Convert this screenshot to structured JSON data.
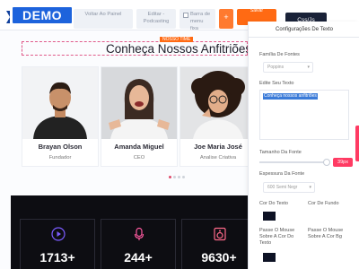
{
  "topbar": {
    "logo": "DEMO",
    "back_label": "Voltar Ao Painel",
    "edit_label": "Editar - Podcasting",
    "menu_fixed_label": "Barra de menu fixa",
    "add_label": "+",
    "orange_label": "Salvar",
    "css_js_label": "Css/Js"
  },
  "section": {
    "tag": "NOSSO TIME",
    "title": "Conheça Nossos Anfitriões"
  },
  "team": [
    {
      "name": "Brayan Olson",
      "role": "Fundador"
    },
    {
      "name": "Amanda Miguel",
      "role": "CEO"
    },
    {
      "name": "Joe Maria José",
      "role": "Analise Criativa"
    }
  ],
  "stats": [
    {
      "value": "1713+",
      "icon": "play-icon"
    },
    {
      "value": "244+",
      "icon": "microphone-icon"
    },
    {
      "value": "9630+",
      "icon": "speaker-icon"
    }
  ],
  "panel": {
    "title": "Configurações De Texto",
    "font_family_label": "Família De Fontes",
    "font_family_value": "Poppins",
    "edit_text_label": "Edite Seu Texto",
    "edit_text_value": "Conheça nossos anfitriões",
    "font_size_label": "Tamanho Da Fonte",
    "font_size_value": "39px",
    "font_weight_label": "Espessura Da Fonte",
    "font_weight_value": "600 Semi Negr",
    "text_color_label": "Cor Do Texto",
    "bg_color_label": "Cor De Fundo",
    "hover_text_color_label": "Passe O Mouse Sobre A Cor Do Texto",
    "hover_bg_color_label": "Passe O Mouse Sobre A Cor Bg"
  },
  "colors": {
    "brand": "#1d63dc",
    "accent": "#ff6a13",
    "pink": "#ff3b63",
    "dark": "#0d0d12"
  }
}
